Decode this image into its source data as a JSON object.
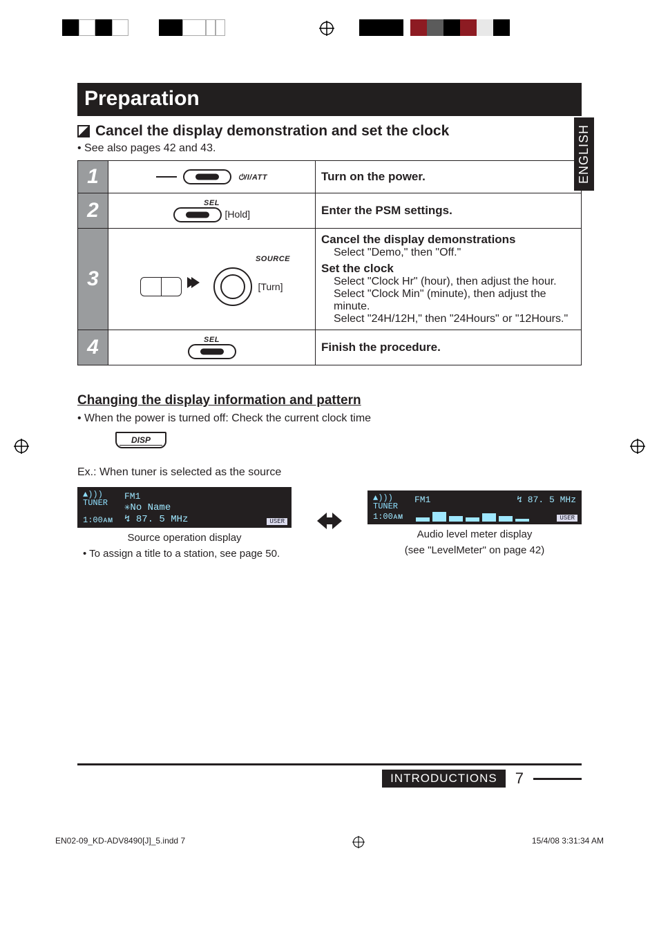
{
  "crop_colors": [
    "#000000",
    "#000000",
    "#000000",
    "#ffffff",
    "#000000"
  ],
  "language_tab": "ENGLISH",
  "section_title": "Preparation",
  "subsection_title": "Cancel the display demonstration and set the clock",
  "subsection_note": "• See also pages 42 and 43.",
  "steps": [
    {
      "num": "1",
      "btn_label": "⏻/I/ATT",
      "desc_title": "Turn on the power.",
      "lines": []
    },
    {
      "num": "2",
      "btn_label": "SEL",
      "action_label": "[Hold]",
      "desc_title": "Enter the PSM settings.",
      "lines": []
    },
    {
      "num": "3",
      "btn_label": "SOURCE",
      "action_label": "[Turn]",
      "desc_title": "Cancel the display demonstrations",
      "lines": [
        "Select \"Demo,\" then \"Off.\""
      ],
      "desc_title2": "Set the clock",
      "lines2": [
        "Select \"Clock Hr\" (hour), then adjust the hour.",
        "Select \"Clock Min\" (minute), then adjust the minute.",
        "Select \"24H/12H,\" then \"24Hours\" or \"12Hours.\""
      ]
    },
    {
      "num": "4",
      "btn_label": "SEL",
      "desc_title": "Finish the procedure.",
      "lines": []
    }
  ],
  "subhead2": "Changing the display information and pattern",
  "subline2": "• When the power is turned off: Check the current clock time",
  "disp_label": "DISP",
  "example_prefix": "Ex.:  When tuner is selected as the source",
  "lcd1": {
    "tuner": "TUNER",
    "band": "FM1",
    "name": "✳No  Name",
    "freq": "↯ 87. 5  MHz",
    "clock": "1:00ᴀᴍ",
    "user": "USER"
  },
  "lcd2": {
    "tuner": "TUNER",
    "band": "FM1",
    "freq": "↯ 87. 5  MHz",
    "clock": "1:00ᴀᴍ",
    "user": "USER"
  },
  "caption1a": "Source operation display",
  "caption1b": "• To assign a title to a station, see page 50.",
  "caption2a": "Audio level meter display",
  "caption2b": "(see \"LevelMeter\" on page 42)",
  "footer_label": "INTRODUCTIONS",
  "page_number": "7",
  "imprint_file": "EN02-09_KD-ADV8490[J]_5.indd   7",
  "imprint_time": "15/4/08   3:31:34 AM"
}
